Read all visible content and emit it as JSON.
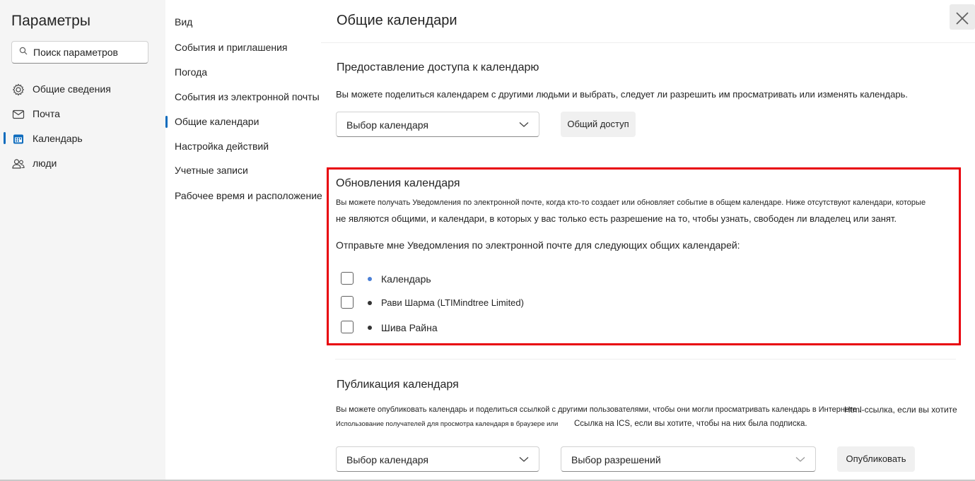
{
  "sidebar": {
    "title": "Параметры",
    "search_placeholder": "Поиск параметров",
    "items": [
      {
        "label": "Общие сведения",
        "icon": "gear-icon"
      },
      {
        "label": "Почта",
        "icon": "mail-icon"
      },
      {
        "label": "Календарь",
        "icon": "calendar-icon",
        "selected": true
      },
      {
        "label": "люди",
        "icon": "people-icon"
      }
    ]
  },
  "subnav": {
    "items": [
      {
        "label": "Вид"
      },
      {
        "label": "События и приглашения"
      },
      {
        "label": "Погода"
      },
      {
        "label": "События из электронной почты"
      },
      {
        "label": "Общие календари",
        "selected": true
      },
      {
        "label": "Настройка действий"
      },
      {
        "label": "Учетные записи"
      },
      {
        "label": "Рабочее время и расположение"
      }
    ]
  },
  "main": {
    "title": "Общие календари",
    "sharing": {
      "title": "Предоставление доступа к календарю",
      "desc": "Вы можете поделиться календарем с другими людьми и выбрать, следует ли разрешить им просматривать или изменять календарь.",
      "dropdown_label": "Выбор календаря",
      "button_label": "Общий доступ"
    },
    "updates": {
      "title": "Обновления календаря",
      "desc1": "Вы можете получать Уведомления по электронной почте, когда кто-то создает или обновляет событие в общем календаре. Ниже отсутствуют календари, которые",
      "desc2": "не являются общими, и календари, в которых у вас только есть разрешение на то, чтобы узнать, свободен ли владелец или занят.",
      "prompt": "Отправьте мне Уведомления по электронной почте для следующих общих календарей:",
      "calendars": [
        {
          "label": "Календарь",
          "checked": false,
          "dot_color": "#4a7fd6"
        },
        {
          "label": "Рави Шарма (LTIMindtree Limited)",
          "checked": false,
          "dot_color": "#333333"
        },
        {
          "label": "Шива Райна",
          "checked": false,
          "dot_color": "#333333"
        }
      ]
    },
    "publish": {
      "title": "Публикация календаря",
      "desc1a": "Вы можете опубликовать календарь и поделиться ссылкой с другими пользователями, чтобы они могли просматривать календарь в Интернете .",
      "desc1b": "Html-ссылка, если вы хотите",
      "desc2a": "Использование получателей для просмотра календаря в браузере или",
      "desc2b": "Ссылка на ICS, если вы хотите, чтобы на них была подписка.",
      "calendar_dropdown_label": "Выбор календаря",
      "permission_dropdown_label": "Выбор разрешений",
      "button_label": "Опубликовать"
    }
  },
  "colors": {
    "accent": "#0f6cbd",
    "highlight": "#e8000b"
  }
}
